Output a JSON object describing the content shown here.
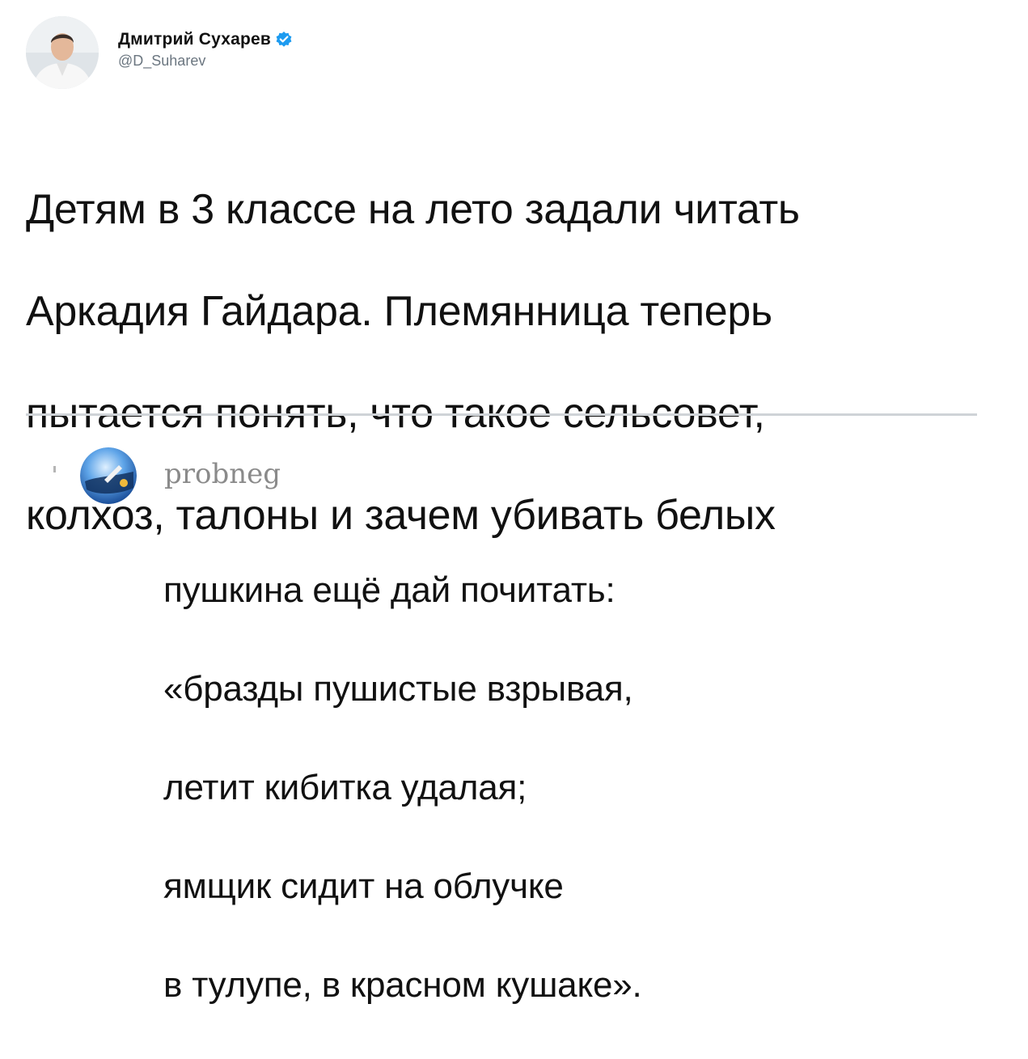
{
  "tweet": {
    "author_name": "Дмитрий Сухарев",
    "author_handle": "@D_Suharev",
    "verified": true,
    "avatar_icon": "profile-photo",
    "text_lines": [
      "Детям в 3 классе на лето задали читать",
      "Аркадия Гайдара. Племянница теперь",
      "пытается понять, что такое сельсовет,",
      "колхоз, талоны и зачем убивать белых"
    ]
  },
  "comment": {
    "author_name": "probneg",
    "avatar_icon": "globe-avatar",
    "text_lines": [
      "пушкина ещё дай почитать:",
      "«бразды пушистые взрывая,",
      "летит кибитка удалая;",
      "ямщик сидит на облучке",
      "в тулупе, в красном кушаке»."
    ]
  },
  "colors": {
    "verified_badge": "#1d9bf0",
    "handle": "#6b7680",
    "divider": "#cfd3d7",
    "comment_author": "#8a8a8a"
  }
}
